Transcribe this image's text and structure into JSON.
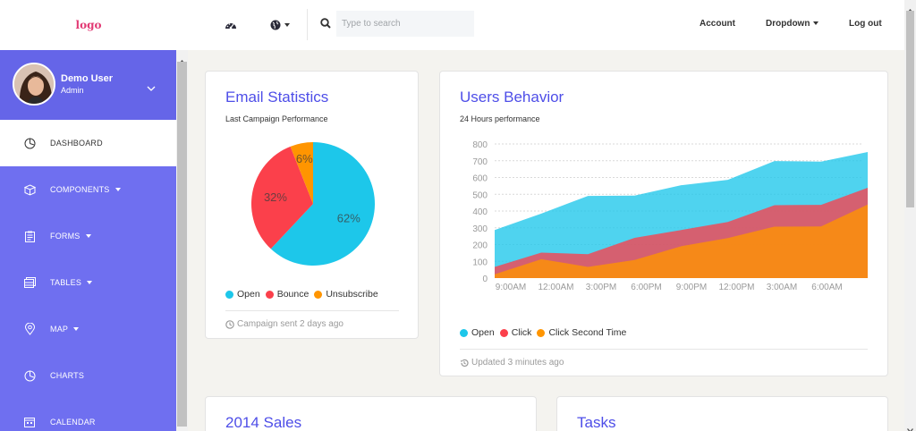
{
  "topbar": {
    "logo": "logo",
    "search_placeholder": "Type to search",
    "account": "Account",
    "dropdown": "Dropdown",
    "logout": "Log out"
  },
  "user": {
    "name": "Demo User",
    "role": "Admin"
  },
  "sidebar": {
    "items": [
      {
        "label": "DASHBOARD",
        "icon": "dashboard-icon",
        "active": true
      },
      {
        "label": "COMPONENTS",
        "icon": "cube-icon",
        "caret": true
      },
      {
        "label": "FORMS",
        "icon": "clipboard-icon",
        "caret": true
      },
      {
        "label": "TABLES",
        "icon": "table-icon",
        "caret": true
      },
      {
        "label": "MAP",
        "icon": "map-pin-icon",
        "caret": true
      },
      {
        "label": "CHARTS",
        "icon": "pie-chart-icon"
      },
      {
        "label": "CALENDAR",
        "icon": "calendar-icon"
      }
    ]
  },
  "email_stats": {
    "title": "Email Statistics",
    "subtitle": "Last Campaign Performance",
    "footer": "Campaign sent 2 days ago",
    "legend": [
      "Open",
      "Bounce",
      "Unsubscribe"
    ],
    "slice_labels": [
      "62%",
      "32%",
      "6%"
    ]
  },
  "users_behavior": {
    "title": "Users Behavior",
    "subtitle": "24 Hours performance",
    "footer": "Updated 3 minutes ago",
    "legend": [
      "Open",
      "Click",
      "Click Second Time"
    ],
    "y_ticks": [
      "800",
      "700",
      "600",
      "500",
      "400",
      "300",
      "200",
      "100",
      "0"
    ],
    "x_ticks": [
      "9:00AM",
      "12:00AM",
      "3:00PM",
      "6:00PM",
      "9:00PM",
      "12:00PM",
      "3:00AM",
      "6:00AM"
    ]
  },
  "sales": {
    "title": "2014 Sales"
  },
  "tasks": {
    "title": "Tasks"
  },
  "colors": {
    "accent": "#4e4ee8",
    "sidebar": "#6f6ff0",
    "open": "#1dc7ea",
    "bounce": "#fb404b",
    "unsubscribe": "#ff9500"
  },
  "chart_data": [
    {
      "type": "pie",
      "title": "Email Statistics",
      "categories": [
        "Open",
        "Bounce",
        "Unsubscribe"
      ],
      "values": [
        62,
        32,
        6
      ],
      "colors": [
        "#1dc7ea",
        "#fb404b",
        "#ff9500"
      ],
      "legend": "bottom"
    },
    {
      "type": "area",
      "title": "Users Behavior",
      "x": [
        "9:00AM",
        "12:00AM",
        "3:00PM",
        "6:00PM",
        "9:00PM",
        "12:00PM",
        "3:00AM",
        "6:00AM"
      ],
      "ylim": [
        0,
        800
      ],
      "grid": true,
      "legend": "bottom",
      "series": [
        {
          "name": "Open",
          "color": "#1dc7ea",
          "values": [
            287,
            385,
            490,
            492,
            554,
            586,
            698,
            695,
            752
          ]
        },
        {
          "name": "Click",
          "color": "#fb404b",
          "values": [
            67,
            152,
            143,
            240,
            287,
            335,
            435,
            437,
            539
          ]
        },
        {
          "name": "Click Second Time",
          "color": "#ff9500",
          "values": [
            23,
            113,
            67,
            108,
            190,
            239,
            307,
            308,
            439
          ]
        }
      ]
    }
  ]
}
